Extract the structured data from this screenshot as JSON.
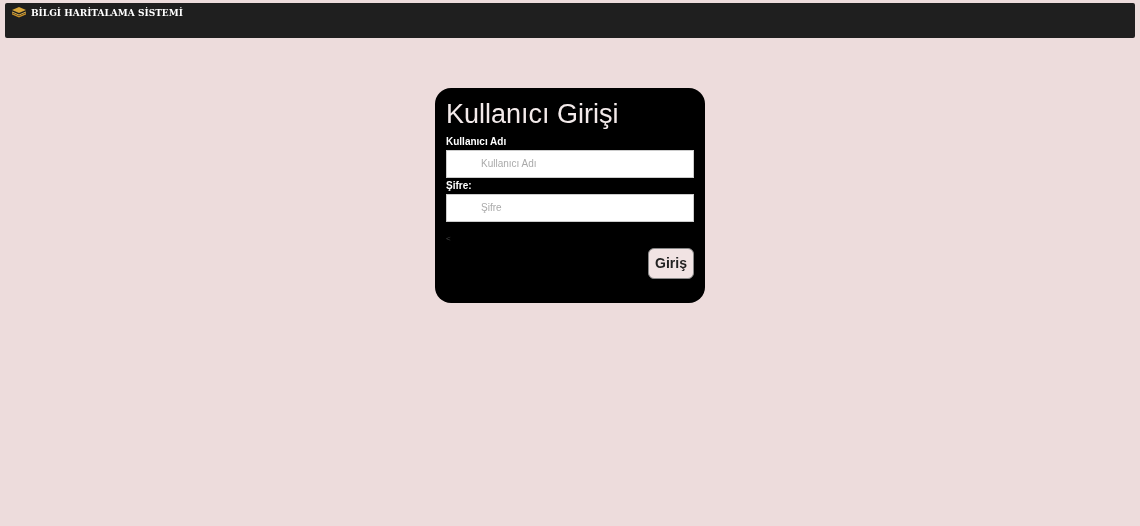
{
  "header": {
    "title": "BİLGİ HARİTALAMA SİSTEMİ"
  },
  "login": {
    "title": "Kullanıcı Girişi",
    "fields": [
      {
        "label": "Kullanıcı Adı",
        "placeholder": "Kullanıcı Adı"
      },
      {
        "label": "Şifre:",
        "placeholder": "Şifre"
      }
    ],
    "stray_mark": "<",
    "button": "Giriş"
  }
}
